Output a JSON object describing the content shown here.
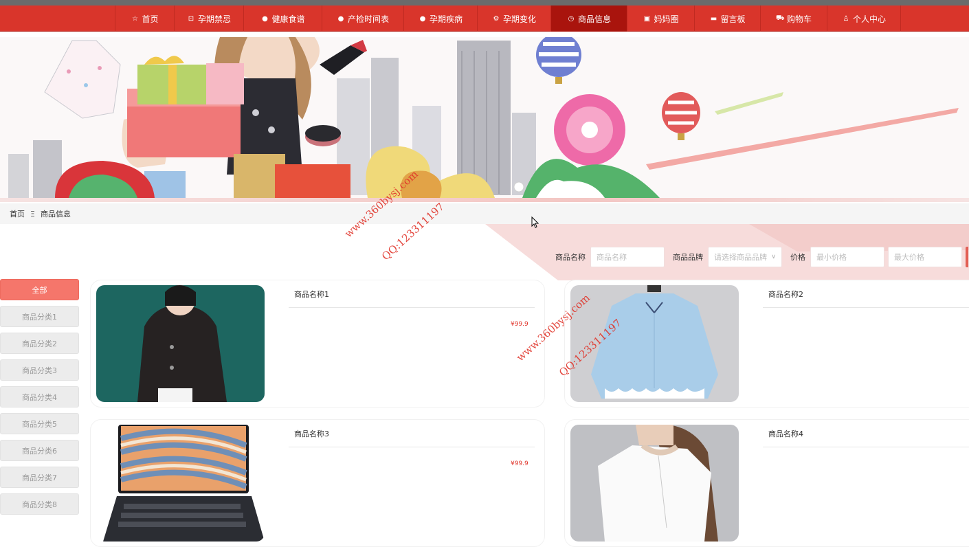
{
  "nav": {
    "items": [
      {
        "label": "首页",
        "icon": "star-icon",
        "glyph": "☆"
      },
      {
        "label": "孕期禁忌",
        "icon": "bag-icon",
        "glyph": "⊡"
      },
      {
        "label": "健康食谱",
        "icon": "dot-icon",
        "glyph": "●"
      },
      {
        "label": "产检时间表",
        "icon": "dot-icon",
        "glyph": "●"
      },
      {
        "label": "孕期疾病",
        "icon": "info-icon",
        "glyph": "●"
      },
      {
        "label": "孕期变化",
        "icon": "settings-icon",
        "glyph": "⚙"
      },
      {
        "label": "商品信息",
        "icon": "circle-check-icon",
        "glyph": "◷"
      },
      {
        "label": "妈妈圈",
        "icon": "camera-icon",
        "glyph": "▣"
      },
      {
        "label": "留言板",
        "icon": "truck-icon",
        "glyph": "▬"
      },
      {
        "label": "购物车",
        "icon": "cart-icon",
        "glyph": "⛟"
      },
      {
        "label": "个人中心",
        "icon": "user-icon",
        "glyph": "♙"
      }
    ],
    "active_index": 6,
    "color": "#d9352b",
    "active_color": "#a9140d"
  },
  "breadcrumb": {
    "home": "首页",
    "separator": "Ξ",
    "current": "商品信息"
  },
  "filter": {
    "name_label": "商品名称",
    "name_placeholder": "商品名称",
    "brand_label": "商品品牌",
    "brand_placeholder": "请选择商品品牌",
    "price_label": "价格",
    "min_placeholder": "最小价格",
    "max_placeholder": "最大价格"
  },
  "categories": [
    "全部",
    "商品分类1",
    "商品分类2",
    "商品分类3",
    "商品分类4",
    "商品分类5",
    "商品分类6",
    "商品分类7",
    "商品分类8"
  ],
  "products": [
    {
      "name": "商品名称1",
      "price": "¥99.9"
    },
    {
      "name": "商品名称2",
      "price": ""
    },
    {
      "name": "商品名称3",
      "price": "¥99.9"
    },
    {
      "name": "商品名称4",
      "price": ""
    }
  ],
  "watermarks": {
    "site": "www.360bysj.com",
    "qq": "QQ:123311197"
  },
  "colors": {
    "accent": "#d9352b",
    "price": "#e0342a",
    "category_active": "#f5766b"
  }
}
